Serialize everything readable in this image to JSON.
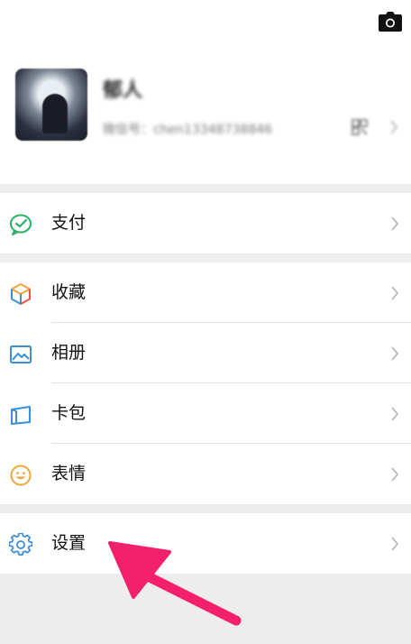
{
  "profile": {
    "nickname": "郁人",
    "wechat_id": "微信号：chen13348738846",
    "camera_icon": "camera-icon",
    "qr_icon": "qr-code-icon"
  },
  "menu": {
    "pay": {
      "label": "支付",
      "icon": "wechat-pay-icon",
      "color": "#2aae67"
    },
    "favorites": {
      "label": "收藏",
      "icon": "favorites-cube-icon",
      "color": "#f2a33a"
    },
    "album": {
      "label": "相册",
      "icon": "album-icon",
      "color": "#3d8fd6"
    },
    "cards": {
      "label": "卡包",
      "icon": "card-wallet-icon",
      "color": "#3d8fd6"
    },
    "stickers": {
      "label": "表情",
      "icon": "sticker-smile-icon",
      "color": "#f0a73a"
    },
    "settings": {
      "label": "设置",
      "icon": "gear-icon",
      "color": "#3d8fd6"
    }
  },
  "annotation": {
    "arrow_color": "#f5206b",
    "points_to": "settings"
  }
}
